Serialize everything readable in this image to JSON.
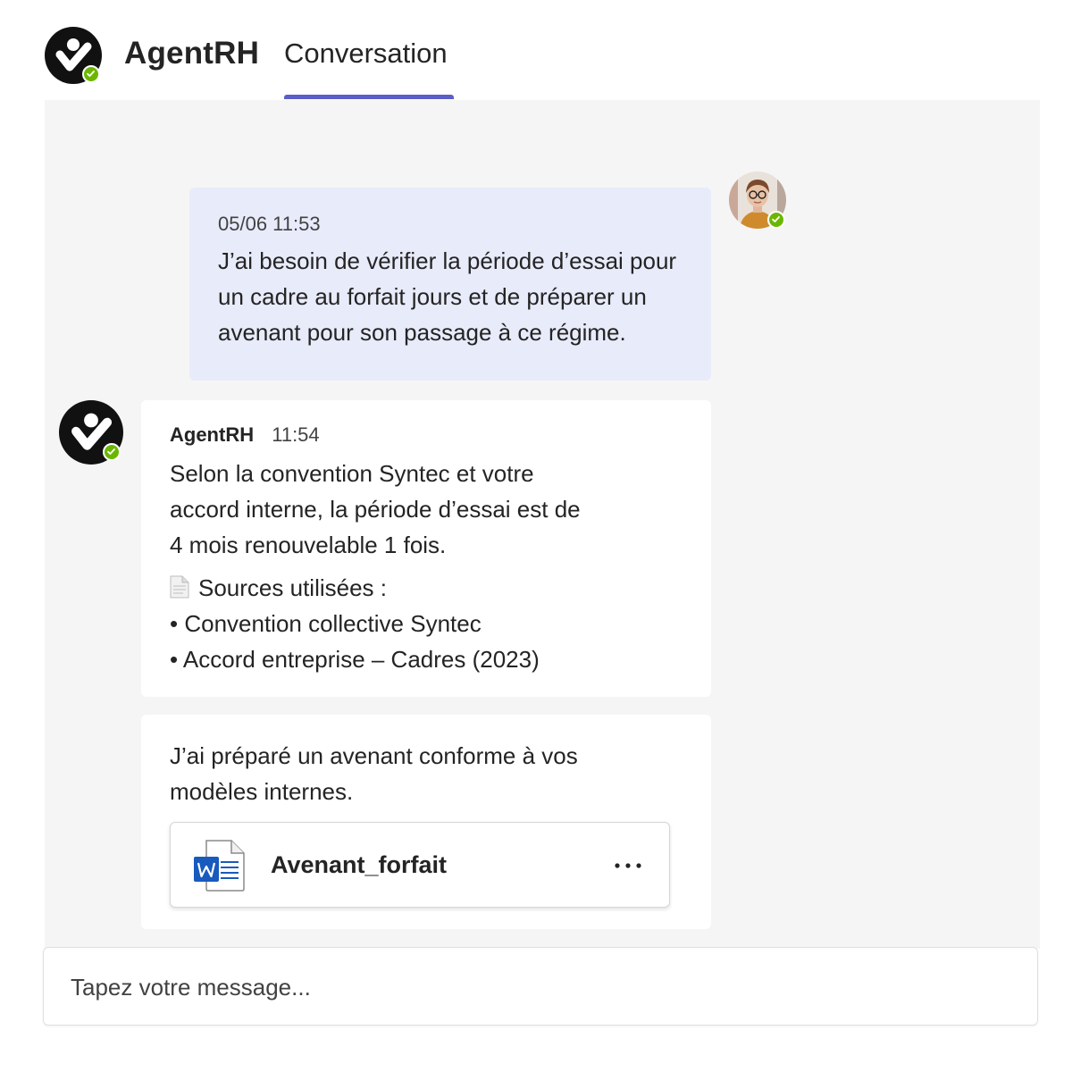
{
  "header": {
    "app_name": "AgentRH",
    "tab_label": "Conversation"
  },
  "user_message": {
    "timestamp": "05/06 11:53",
    "text": "J’ai besoin de vérifier la période d’essai pour un cadre au forfait jours et de préparer un avenant pour son passage à ce régime."
  },
  "bot_message": {
    "sender": "AgentRH",
    "time": "11:54",
    "text": "Selon la convention Syntec et votre accord interne, la période d’essai est de 4 mois renouvelable 1 fois.",
    "sources_title": "Sources utilisées :",
    "sources": [
      "• Convention collective Syntec",
      "• Accord entreprise – Cadres (2023)"
    ]
  },
  "bot_message_2": {
    "text": "J’ai préparé un avenant conforme à vos modèles internes.",
    "file_name": "Avenant_forfait",
    "more_label": "···"
  },
  "composer": {
    "placeholder": "Tapez votre message..."
  },
  "colors": {
    "accent": "#5b5fc7",
    "presence_available": "#6bb700",
    "user_bubble": "#e8ebfa",
    "chat_background": "#f5f5f5",
    "word_blue": "#185abd"
  },
  "icons": {
    "app_logo": "agentrh-logo-icon",
    "presence": "presence-available-icon",
    "document": "document-emoji-icon",
    "file": "word-file-icon",
    "more": "more-options-icon"
  }
}
